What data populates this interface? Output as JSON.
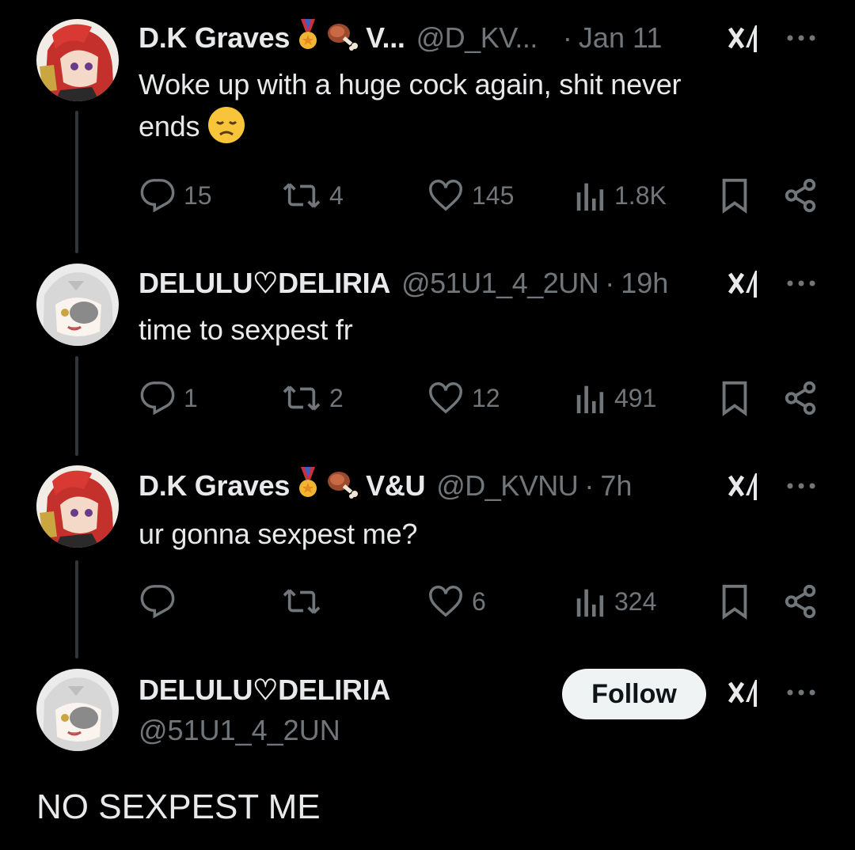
{
  "tweets": [
    {
      "name": "D.K Graves",
      "badge_extra": "V...",
      "handle": "@D_KV...",
      "time": "Jan 11",
      "text_line1": "Woke up with a huge cock again, shit never",
      "text_line2": "ends",
      "emoji": "😞",
      "replies": "15",
      "reposts": "4",
      "likes": "145",
      "views": "1.8K"
    },
    {
      "name": "DELULU♡DELIRIA",
      "handle": "@51U1_4_2UN",
      "time": "19h",
      "text_line1": "time to sexpest fr",
      "replies": "1",
      "reposts": "2",
      "likes": "12",
      "views": "491"
    },
    {
      "name": "D.K Graves",
      "badge_extra": "V&U",
      "handle": "@D_KVNU",
      "time": "7h",
      "text_line1": "ur gonna sexpest me?",
      "replies": "",
      "reposts": "",
      "likes": "6",
      "views": "324"
    }
  ],
  "profile": {
    "name": "DELULU♡DELIRIA",
    "handle": "@51U1_4_2UN",
    "follow_label": "Follow"
  },
  "main_text": "NO SEXPEST ME",
  "colors": {
    "background": "#000000",
    "text": "#e7e9ea",
    "muted": "#71767b",
    "thread_line": "#333639",
    "follow_bg": "#eff3f4"
  },
  "icons": [
    "reply-icon",
    "repost-icon",
    "like-icon",
    "views-icon",
    "bookmark-icon",
    "share-icon",
    "grok-icon",
    "more-icon",
    "medal-badge-icon",
    "meat-badge-icon"
  ]
}
